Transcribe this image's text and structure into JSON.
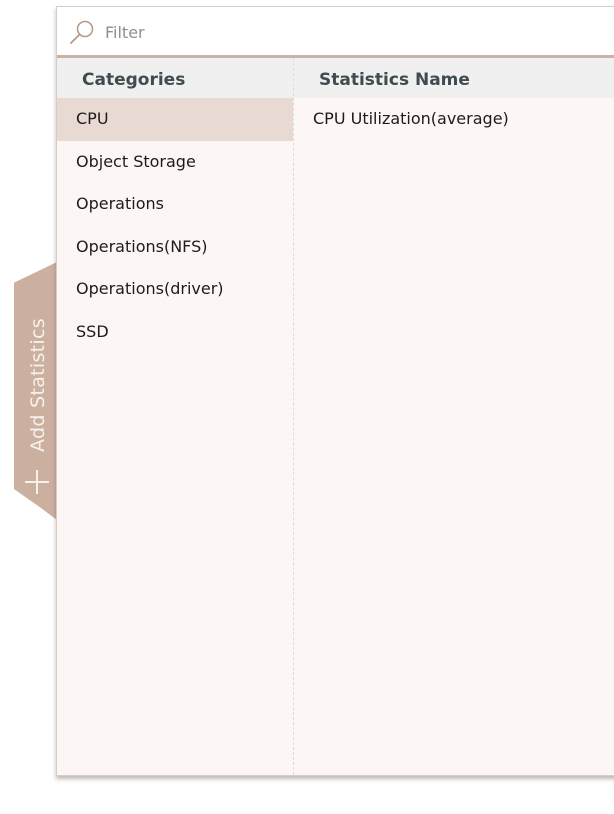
{
  "side_tab": {
    "label": "Add Statistics",
    "icon": "plus-icon",
    "color": "#cbaf9f"
  },
  "filter": {
    "placeholder": "Filter",
    "value": "",
    "icon": "search-icon"
  },
  "columns": {
    "categories": "Categories",
    "statistics_name": "Statistics Name"
  },
  "categories": [
    {
      "label": "CPU",
      "selected": true
    },
    {
      "label": "Object Storage",
      "selected": false
    },
    {
      "label": "Operations",
      "selected": false
    },
    {
      "label": "Operations(NFS)",
      "selected": false
    },
    {
      "label": "Operations(driver)",
      "selected": false
    },
    {
      "label": "SSD",
      "selected": false
    }
  ],
  "statistics": [
    {
      "label": "CPU Utilization(average)"
    }
  ],
  "colors": {
    "accent": "#c8b3a6",
    "selected_row": "#e8dad3",
    "panel_background": "#fcf7f4",
    "header_background": "#f0f0f0",
    "header_text": "#3f4c4f"
  }
}
